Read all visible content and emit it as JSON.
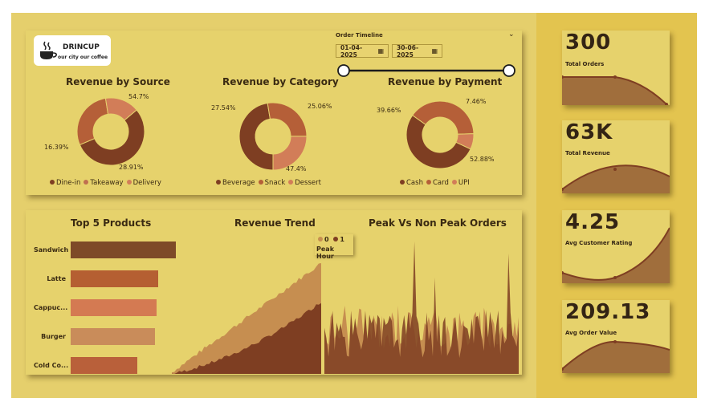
{
  "brand": {
    "name": "DRINCUP",
    "tagline": "our city our coffee"
  },
  "order_timeline": {
    "title": "Order Timeline",
    "start": "01-04-2025",
    "end": "30-06-2025"
  },
  "colors": {
    "dark": "#7e3e22",
    "mid": "#b55f38",
    "light": "#d27d58",
    "tan": "#c68e50",
    "accent": "#bc5b33"
  },
  "donuts": [
    {
      "title": "Revenue by Source",
      "chart_data": {
        "type": "pie",
        "labels": [
          "Dine-in",
          "Takeaway",
          "Delivery"
        ],
        "values": [
          54.7,
          28.91,
          16.39
        ]
      },
      "value_labels": [
        "54.7%",
        "28.91%",
        "16.39%"
      ],
      "legend": [
        "Dine-in",
        "Takeaway",
        "Delivery"
      ]
    },
    {
      "title": "Revenue by Category",
      "chart_data": {
        "type": "pie",
        "labels": [
          "Beverage",
          "Snack",
          "Dessert"
        ],
        "values": [
          47.4,
          27.54,
          25.06
        ]
      },
      "value_labels": [
        "47.4%",
        "27.54%",
        "25.06%"
      ],
      "legend": [
        "Beverage",
        "Snack",
        "Dessert"
      ]
    },
    {
      "title": "Revenue by Payment",
      "chart_data": {
        "type": "pie",
        "labels": [
          "Cash",
          "Card",
          "UPI"
        ],
        "values": [
          52.88,
          39.66,
          7.46
        ]
      },
      "value_labels": [
        "52.88%",
        "39.66%",
        "7.46%"
      ],
      "legend": [
        "Cash",
        "Card",
        "UPI"
      ]
    }
  ],
  "top_products": {
    "title": "Top 5 Products",
    "chart_data": {
      "type": "bar",
      "categories": [
        "Sandwich",
        "Latte",
        "Cappuc...",
        "Burger",
        "Cold Co..."
      ],
      "values": [
        100,
        83,
        82,
        80,
        63
      ]
    }
  },
  "revenue_trend": {
    "title": "Revenue Trend"
  },
  "peak": {
    "title": "Peak Vs Non Peak Orders",
    "legend_title": "Peak Hour",
    "legend_items": [
      "0",
      "1"
    ]
  },
  "kpis": [
    {
      "value": "300",
      "label": "Total Orders"
    },
    {
      "value": "63K",
      "label": "Total Revenue"
    },
    {
      "value": "4.25",
      "label": "Avg Customer Rating"
    },
    {
      "value": "209.13",
      "label": "Avg Order Value"
    }
  ]
}
